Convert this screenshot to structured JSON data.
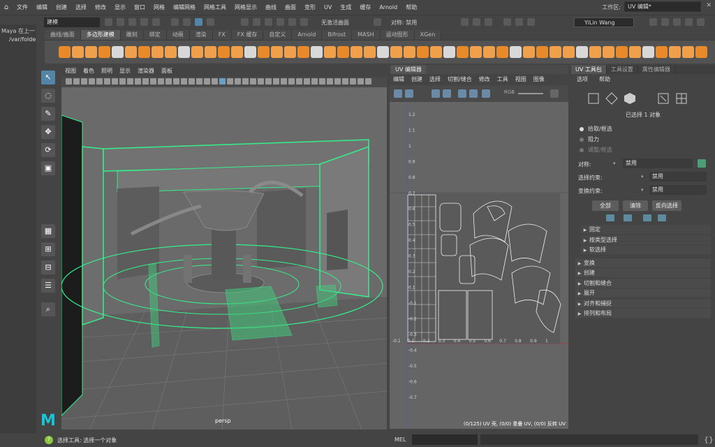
{
  "menubar": {
    "items": [
      "文件",
      "编辑",
      "创建",
      "选择",
      "修改",
      "显示",
      "窗口",
      "网格",
      "编辑网格",
      "网格工具",
      "网格显示",
      "曲线",
      "曲面",
      "变形",
      "UV",
      "生成",
      "缓存",
      "Arnold",
      "帮助"
    ],
    "workspace_label": "工作区:",
    "workspace_value": "UV 编辑*"
  },
  "statusline": {
    "mode": "建模",
    "no_live_surface": "无激活曲面",
    "symmetry": "对称: 禁用",
    "user": "YiLin Wang"
  },
  "left_strip": {
    "title": "Maya 在上一",
    "path": "/var/folde"
  },
  "shelf": {
    "tabs": [
      "曲线/曲面",
      "多边形建模",
      "雕刻",
      "绑定",
      "动画",
      "渲染",
      "FX",
      "FX 缓存",
      "自定义",
      "Arnold",
      "Bifrost",
      "MASH",
      "运动图形",
      "XGen"
    ],
    "active_tab": "多边形建模"
  },
  "viewport": {
    "menus": [
      "视图",
      "着色",
      "照明",
      "显示",
      "渲染器",
      "面板"
    ],
    "camera_label": "persp"
  },
  "uv_editor": {
    "tab": "UV 编辑器",
    "menus": [
      "编辑",
      "创建",
      "选择",
      "切割/缝合",
      "修改",
      "工具",
      "视图",
      "图像"
    ],
    "rgb_label": "RGB",
    "status": "(0/125) UV 壳, (0/0) 重叠 UV, (0/0) 反转 UV",
    "axis_labels_v": [
      "1.2",
      "1.1",
      "1",
      "0.9",
      "0.8",
      "0.7",
      "0.6",
      "0.5",
      "0.4",
      "0.3",
      "0.2",
      "0.1",
      "-0.1",
      "-0.2",
      "-0.3",
      "-0.4",
      "-0.5",
      "-0.6",
      "-0.7"
    ],
    "axis_labels_u": [
      "-0.1",
      "0.1",
      "0.2",
      "0.3",
      "0.4",
      "0.5",
      "0.6",
      "0.7",
      "0.8",
      "0.9",
      "1"
    ]
  },
  "right_panel": {
    "tabs": [
      "UV 工具包",
      "工具设置",
      "属性编辑器"
    ],
    "menus": [
      "选项",
      "帮助"
    ],
    "selected_count": "已选择 1 对象",
    "radios": [
      "拾取/框选",
      "阻力",
      "调整/框选"
    ],
    "symmetry_label": "对称:",
    "symmetry_value": "禁用",
    "select_constraint_label": "选择约束:",
    "select_constraint_value": "禁用",
    "transform_constraint_label": "变换约束:",
    "transform_constraint_value": "禁用",
    "buttons": [
      "全部",
      "清除",
      "反向选择"
    ],
    "sub_sections": [
      "固定",
      "按类型选择",
      "软选择"
    ],
    "sections": [
      "变换",
      "创建",
      "切割和缝合",
      "展开",
      "对齐和捕捉",
      "排列和布局"
    ]
  },
  "cmdline": {
    "help": "选择工具: 选择一个对象",
    "mel_label": "MEL"
  },
  "colors": {
    "accent": "#5285a6",
    "wire_green": "#34f08a",
    "maya_logo": "#19c4d6",
    "shelf_orange": "#f0962d"
  }
}
